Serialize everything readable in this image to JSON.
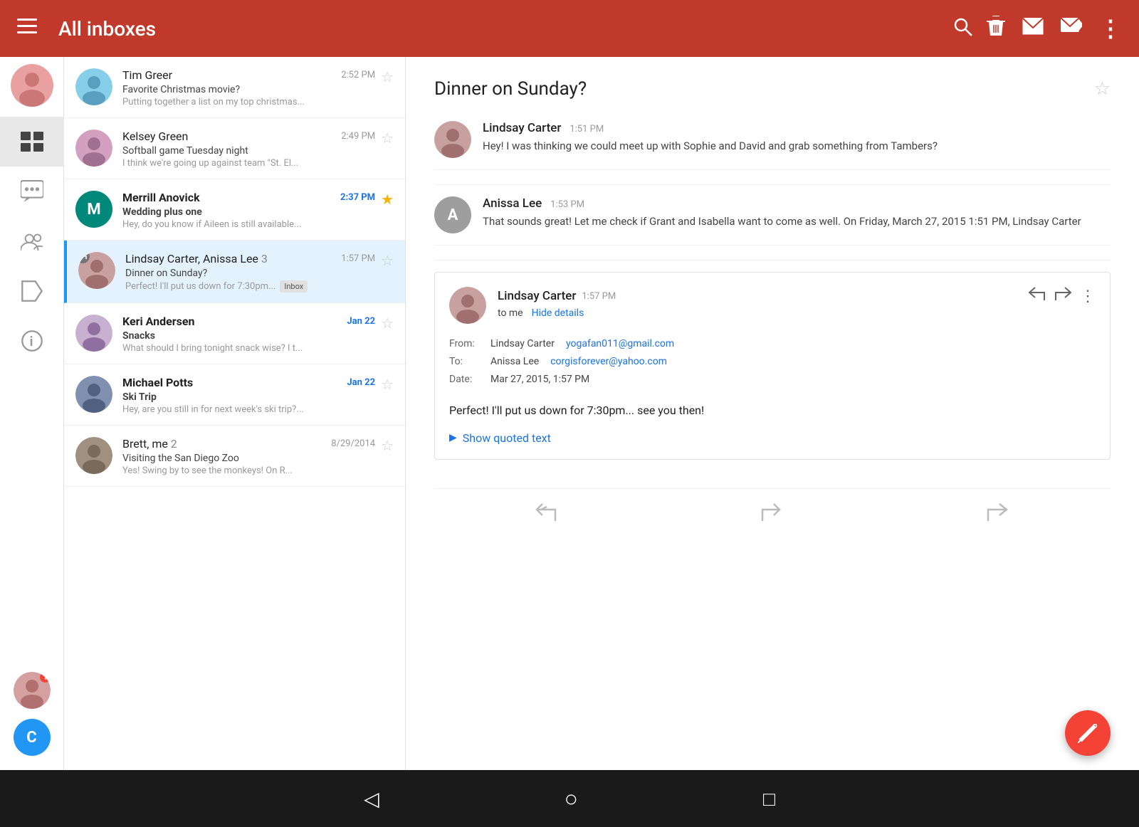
{
  "topBar": {
    "title": "All inboxes",
    "icons": {
      "menu": "☰",
      "search": "🔍",
      "delete": "🗑",
      "mail": "✉",
      "forward": "➡",
      "more": "⋮"
    }
  },
  "sidebar": {
    "icons": [
      "all_inbox",
      "chat",
      "people",
      "label",
      "info"
    ],
    "bottomAvatars": [
      "user_photo",
      "C"
    ]
  },
  "emailList": [
    {
      "sender": "Tim Greer",
      "subject": "Favorite Christmas movie?",
      "preview": "Putting together a list on my top christmas...",
      "time": "2:52 PM",
      "starred": false,
      "unread": false,
      "avatarType": "image",
      "avatarColor": ""
    },
    {
      "sender": "Kelsey Green",
      "subject": "Softball game Tuesday night",
      "preview": "I think we're going up against team \"St. El...",
      "time": "2:49 PM",
      "starred": false,
      "unread": false,
      "avatarType": "image",
      "avatarColor": ""
    },
    {
      "sender": "Merrill Anovick",
      "subject": "Wedding plus one",
      "preview": "Hey, do you know if Aileen is still available...",
      "time": "2:37 PM",
      "starred": true,
      "unread": true,
      "avatarType": "letter",
      "avatarLetter": "M",
      "avatarColor": "#00897b"
    },
    {
      "sender": "Lindsay Carter, Anissa Lee",
      "senderCount": "3",
      "subject": "Dinner on Sunday?",
      "preview": "Perfect! I'll put us down for 7:30pm...",
      "time": "1:57 PM",
      "starred": false,
      "unread": false,
      "active": true,
      "avatarType": "image",
      "avatarColor": "",
      "badge": "Inbox"
    },
    {
      "sender": "Keri Andersen",
      "subject": "Snacks",
      "preview": "What should I bring tonight snack wise? I t...",
      "time": "Jan 22",
      "starred": false,
      "unread": true,
      "avatarType": "image",
      "avatarColor": ""
    },
    {
      "sender": "Michael Potts",
      "subject": "Ski Trip",
      "preview": "Hey, are you still in for next week's ski trip?...",
      "time": "Jan 22",
      "starred": false,
      "unread": true,
      "avatarType": "image",
      "avatarColor": ""
    },
    {
      "sender": "Brett, me",
      "senderCount": "2",
      "subject": "Visiting the San Diego Zoo",
      "preview": "Yes! Swing by to see the monkeys! On R...",
      "time": "8/29/2014",
      "starred": false,
      "unread": false,
      "avatarType": "image",
      "avatarColor": ""
    }
  ],
  "detail": {
    "title": "Dinner on Sunday?",
    "messages": [
      {
        "sender": "Lindsay Carter",
        "time": "1:51 PM",
        "body": "Hey! I was thinking we could meet up with Sophie and David and grab something from Tambers?",
        "avatarType": "image",
        "avatarColor": ""
      },
      {
        "sender": "Anissa Lee",
        "time": "1:53 PM",
        "body": "That sounds great! Let me check if Grant and Isabella want to come as well. On Friday, March 27, 2015 1:51 PM, Lindsay Carter",
        "avatarType": "letter",
        "avatarLetter": "A",
        "avatarColor": "#9e9e9e"
      },
      {
        "sender": "Lindsay Carter",
        "time": "1:57 PM",
        "toLabel": "to me",
        "hideDetails": "Hide details",
        "from": "Lindsay Carter",
        "fromEmail": "yogafan011@gmail.com",
        "to": "Anissa Lee",
        "toEmail": "corgisforever@yahoo.com",
        "date": "Mar 27, 2015, 1:57 PM",
        "messageText": "Perfect! I'll put us down for 7:30pm... see you then!",
        "showQuotedText": "Show quoted text",
        "avatarType": "image",
        "avatarColor": ""
      }
    ],
    "bottomActions": [
      "↩",
      "↪",
      "↩↩"
    ]
  },
  "fab": {
    "icon": "✏"
  },
  "bottomNav": {
    "back": "◁",
    "home": "○",
    "square": "□"
  }
}
